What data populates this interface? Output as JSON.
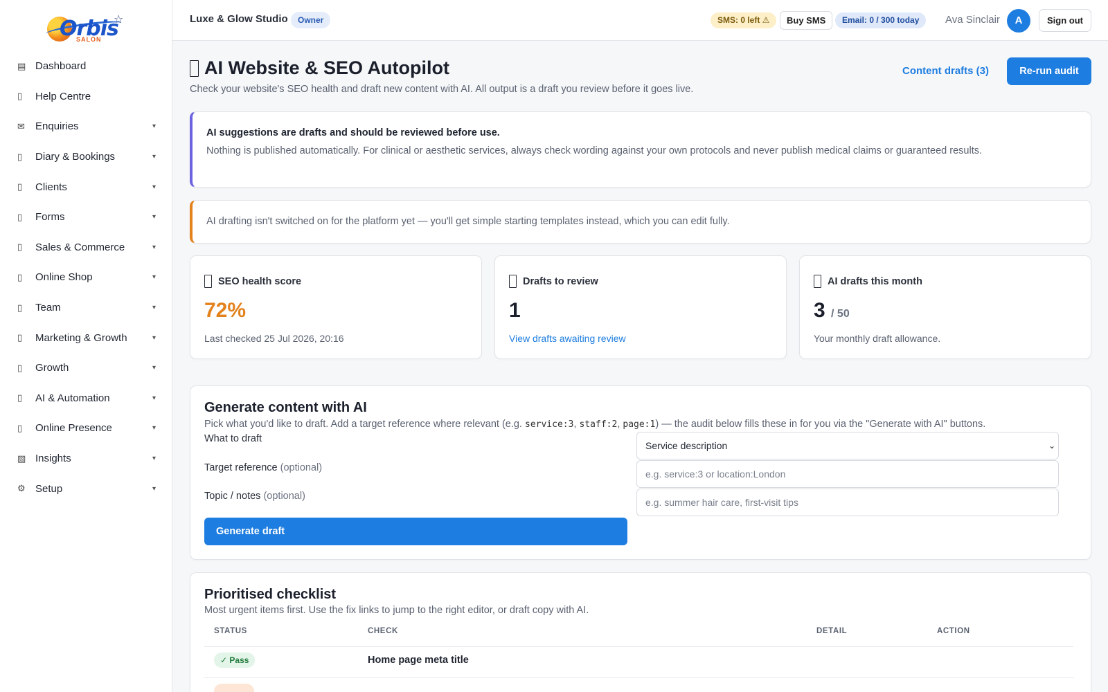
{
  "brand": {
    "logo_word": "Orbis",
    "logo_sub": "SALON"
  },
  "sidebar": {
    "items": [
      {
        "label": "Dashboard",
        "icon": "▤",
        "icon_name": "dashboard-icon",
        "chevron": ""
      },
      {
        "label": "Help Centre",
        "icon": "▯",
        "icon_name": "help-icon",
        "chevron": ""
      },
      {
        "label": "Enquiries",
        "icon": "✉",
        "icon_name": "envelope-icon",
        "chevron": "▾"
      },
      {
        "label": "Diary & Bookings",
        "icon": "▯",
        "icon_name": "calendar-icon",
        "chevron": "▾"
      },
      {
        "label": "Clients",
        "icon": "▯",
        "icon_name": "clients-icon",
        "chevron": "▾"
      },
      {
        "label": "Forms",
        "icon": "▯",
        "icon_name": "forms-icon",
        "chevron": "▾"
      },
      {
        "label": "Sales & Commerce",
        "icon": "▯",
        "icon_name": "sales-icon",
        "chevron": "▾"
      },
      {
        "label": "Online Shop",
        "icon": "▯",
        "icon_name": "shop-icon",
        "chevron": "▾"
      },
      {
        "label": "Team",
        "icon": "▯",
        "icon_name": "team-icon",
        "chevron": "▾"
      },
      {
        "label": "Marketing & Growth",
        "icon": "▯",
        "icon_name": "marketing-icon",
        "chevron": "▾"
      },
      {
        "label": "Growth",
        "icon": "▯",
        "icon_name": "growth-icon",
        "chevron": "▾"
      },
      {
        "label": "AI & Automation",
        "icon": "▯",
        "icon_name": "ai-icon",
        "chevron": "▾"
      },
      {
        "label": "Online Presence",
        "icon": "▯",
        "icon_name": "globe-icon",
        "chevron": "▾"
      },
      {
        "label": "Insights",
        "icon": "▧",
        "icon_name": "insights-icon",
        "chevron": "▾"
      },
      {
        "label": "Setup",
        "icon": "⚙",
        "icon_name": "gear-icon",
        "chevron": "▾"
      }
    ]
  },
  "topbar": {
    "studio_name": "Luxe & Glow Studio",
    "role_badge": "Owner",
    "sms_status": "SMS: 0 left ⚠",
    "buy_sms": "Buy SMS",
    "email_status": "Email: 0 / 300 today",
    "user_name": "Ava Sinclair",
    "avatar_initial": "A",
    "sign_out": "Sign out"
  },
  "header": {
    "title": "AI Website & SEO Autopilot",
    "subtitle": "Check your website's SEO health and draft new content with AI. All output is a draft you review before it goes live.",
    "drafts_link": "Content drafts (3)",
    "rerun_button": "Re-run audit"
  },
  "alerts": {
    "review_heading": "AI suggestions are drafts and should be reviewed before use.",
    "review_body": "Nothing is published automatically. For clinical or aesthetic services, always check wording against your own protocols and never publish medical claims or guaranteed results.",
    "ai_off_body": "AI drafting isn't switched on for the platform yet — you'll get simple starting templates instead, which you can edit fully."
  },
  "stats": {
    "seo": {
      "title": "SEO health score",
      "value": "72%",
      "note": "Last checked 25 Jul 2026, 20:16"
    },
    "drafts": {
      "title": "Drafts to review",
      "value": "1",
      "link": "View drafts awaiting review"
    },
    "ai_month": {
      "title": "AI drafts this month",
      "value": "3",
      "limit": "/ 50",
      "note": "Your monthly draft allowance."
    }
  },
  "generate": {
    "heading": "Generate content with AI",
    "sub_prefix": "Pick what you'd like to draft. Add a target reference where relevant (e.g. ",
    "code1": "service:3",
    "sep1": ", ",
    "code2": "staff:2",
    "sep2": ", ",
    "code3": "page:1",
    "sub_suffix": ") — the audit below fills these in for you via the \"Generate with AI\" buttons.",
    "what_label": "What to draft",
    "what_value": "Service description",
    "target_label": "Target reference",
    "target_optional": "(optional)",
    "target_placeholder": "e.g. service:3 or location:London",
    "topic_label": "Topic / notes",
    "topic_optional": "(optional)",
    "topic_placeholder": "e.g. summer hair care, first-visit tips",
    "button": "Generate draft"
  },
  "checklist": {
    "heading": "Prioritised checklist",
    "sub": "Most urgent items first. Use the fix links to jump to the right editor, or draft copy with AI.",
    "columns": {
      "status": "STATUS",
      "check": "CHECK",
      "detail": "DETAIL",
      "action": "ACTION"
    },
    "rows": [
      {
        "status": "✓ Pass",
        "check": "Home page meta title"
      }
    ]
  },
  "colors": {
    "accent": "#1e7de0",
    "score": "#e3821c",
    "alert_purple": "#6b63e0",
    "alert_orange": "#e3821c"
  }
}
